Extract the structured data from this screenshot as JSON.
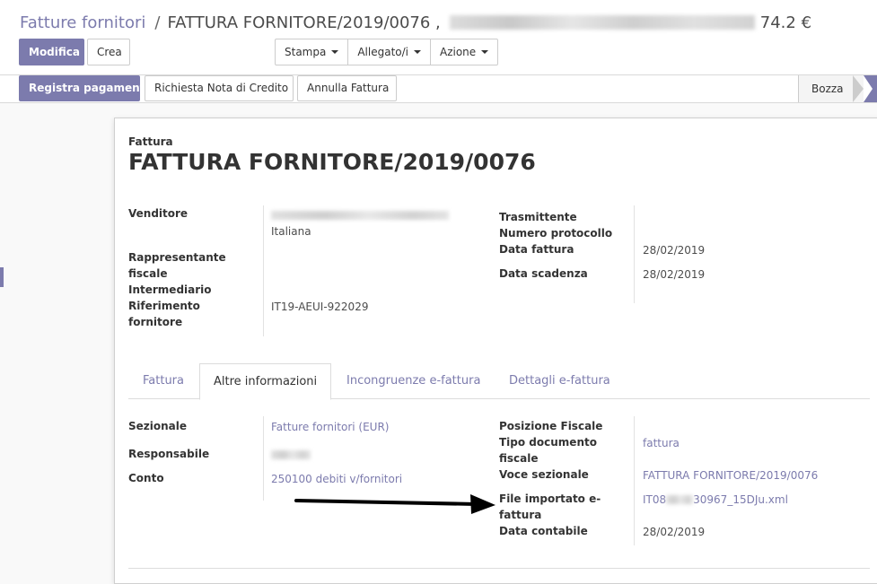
{
  "breadcrumb": {
    "parent": "Fatture fornitori",
    "separator": "/",
    "current": "FATTURA FORNITORE/2019/0076 ,",
    "amount": "74.2 €"
  },
  "toolbar": {
    "edit_label": "Modifica",
    "create_label": "Crea",
    "print_label": "Stampa",
    "attachment_label": "Allegato/i",
    "action_label": "Azione"
  },
  "statusbar": {
    "register_payment": "Registra pagamenti",
    "credit_note": "Richiesta Nota di Credito",
    "cancel_invoice": "Annulla Fattura",
    "state": "Bozza"
  },
  "form": {
    "doc_type": "Fattura",
    "title": "FATTURA FORNITORE/2019/0076",
    "left_labels": {
      "vendor": "Venditore",
      "fiscal_rep_1": "Rappresentante",
      "fiscal_rep_2": "fiscale",
      "intermediary": "Intermediario",
      "vendor_ref_1": "Riferimento",
      "vendor_ref_2": "fornitore"
    },
    "vendor_country": "Italiana",
    "vendor_ref": "IT19-AEUI-922029",
    "right_labels": {
      "transmitter": "Trasmittente",
      "protocol": "Numero protocollo",
      "invoice_date": "Data fattura",
      "due_date": "Data scadenza"
    },
    "invoice_date": "28/02/2019",
    "due_date": "28/02/2019"
  },
  "tabs": [
    {
      "label": "Fattura"
    },
    {
      "label": "Altre informazioni"
    },
    {
      "label": "Incongruenze e-fattura"
    },
    {
      "label": "Dettagli e-fattura"
    }
  ],
  "other_info": {
    "journal_label": "Sezionale",
    "journal": "Fatture fornitori (EUR)",
    "responsible_label": "Responsabile",
    "account_label": "Conto",
    "account": "250100 debiti v/fornitori",
    "fiscal_position_label": "Posizione Fiscale",
    "doc_type_label_1": "Tipo documento",
    "doc_type_label_2": "fiscale",
    "doc_type": "fattura",
    "journal_entry_label": "Voce sezionale",
    "journal_entry": "FATTURA FORNITORE/2019/0076",
    "imported_file_label_1": "File importato e-",
    "imported_file_label_2": "fattura",
    "imported_file_prefix": "IT08",
    "imported_file_suffix": "30967_15DJu.xml",
    "accounting_date_label": "Data contabile",
    "accounting_date": "28/02/2019"
  },
  "colors": {
    "primary": "#7c7bad",
    "link": "#7c7bad",
    "arrow": "#000000"
  }
}
